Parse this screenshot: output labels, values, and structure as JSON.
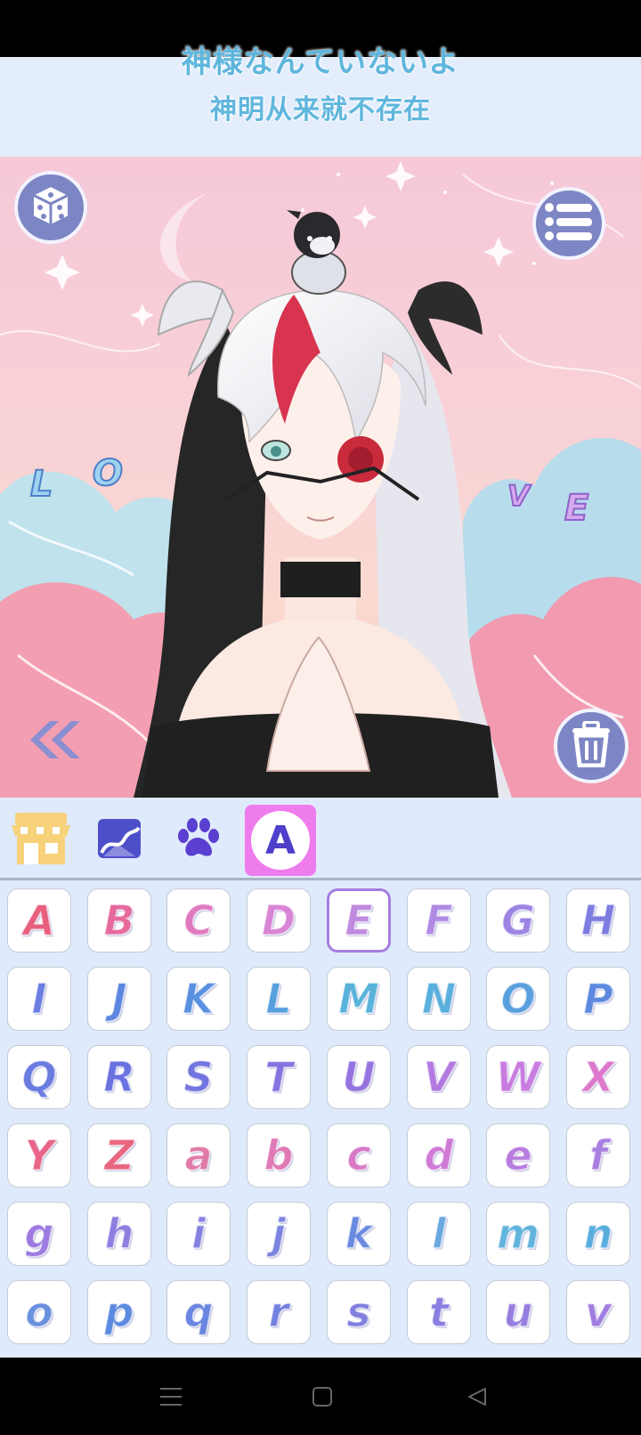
{
  "lyrics": {
    "line_japanese": "神様なんていないよ",
    "line_chinese": "神明从来就不存在"
  },
  "canvas": {
    "floating_letters_left": [
      "L",
      "O"
    ],
    "floating_letters_right": [
      "V",
      "E"
    ],
    "buttons": {
      "random_icon": "dice-icon",
      "menu_icon": "list-icon",
      "back_icon": "double-chevron-left-icon",
      "delete_icon": "trash-icon"
    }
  },
  "toolbar": {
    "tabs": [
      {
        "name": "shop",
        "icon": "shop-icon"
      },
      {
        "name": "background",
        "icon": "landscape-icon"
      },
      {
        "name": "pets",
        "icon": "paw-icon"
      },
      {
        "name": "letters",
        "icon": "letter-a-icon",
        "selected": true,
        "label": "A"
      }
    ],
    "accent_color": "#ee7cec"
  },
  "letter_grid": {
    "selected_key": "E",
    "rows": [
      [
        "A",
        "B",
        "C",
        "D",
        "E",
        "F",
        "G",
        "H"
      ],
      [
        "I",
        "J",
        "K",
        "L",
        "M",
        "N",
        "O",
        "P"
      ],
      [
        "Q",
        "R",
        "S",
        "T",
        "U",
        "V",
        "W",
        "X"
      ],
      [
        "Y",
        "Z",
        "a",
        "b",
        "c",
        "d",
        "e",
        "f"
      ],
      [
        "g",
        "h",
        "i",
        "j",
        "k",
        "l",
        "m",
        "n"
      ],
      [
        "o",
        "p",
        "q",
        "r",
        "s",
        "t",
        "u",
        "v"
      ]
    ],
    "row_colors": [
      [
        "#e8607e",
        "#e66a9c",
        "#e07ac0",
        "#d985d6",
        "#c08ae0",
        "#b08ae5",
        "#9d84e4",
        "#7d7ce0"
      ],
      [
        "#6b7ee0",
        "#5d87e0",
        "#5a90e0",
        "#56a0de",
        "#58b2da",
        "#5ab0dc",
        "#5aa0de",
        "#5d8ae0"
      ],
      [
        "#6a7ce0",
        "#6a72e0",
        "#7274e0",
        "#8674e0",
        "#9674e0",
        "#b27ae0",
        "#c87ce0",
        "#dc78cc"
      ],
      [
        "#e86688",
        "#e86680",
        "#e07aa6",
        "#e07ab6",
        "#d87ac8",
        "#d07ad8",
        "#b87ce0",
        "#a87ee0"
      ],
      [
        "#9c7ae0",
        "#8e7ee0",
        "#8680e0",
        "#7c84e0",
        "#6a8ae0",
        "#6aa8e0",
        "#62b4dc",
        "#5aaede"
      ],
      [
        "#6a90e0",
        "#5c8ae0",
        "#6a86e0",
        "#7480e0",
        "#8080e0",
        "#8a7ee0",
        "#967ee0",
        "#a07ce0"
      ]
    ]
  },
  "nav_bar": {
    "icons": [
      "menu-icon",
      "home-square-icon",
      "back-triangle-icon"
    ]
  }
}
